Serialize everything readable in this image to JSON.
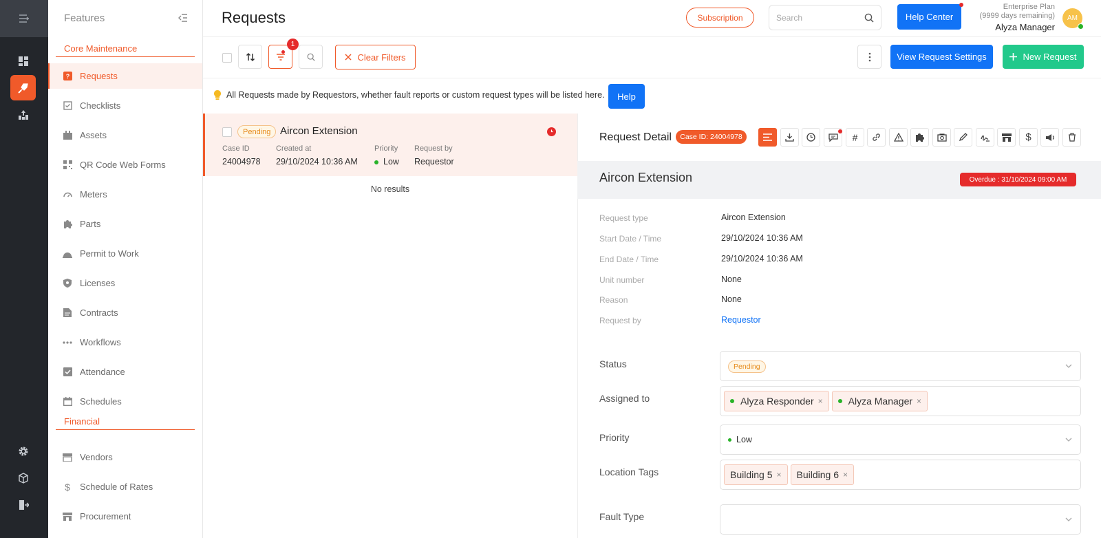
{
  "rail": {
    "icons": [
      "menu-icon",
      "dashboard-icon",
      "maintenance-icon",
      "analytics-icon",
      "settings-icon",
      "cube-icon",
      "logout-icon"
    ]
  },
  "sidebar": {
    "title": "Features",
    "sections": [
      {
        "label": "Core Maintenance"
      },
      {
        "label": "Financial"
      }
    ],
    "items": [
      {
        "label": "Requests"
      },
      {
        "label": "Checklists"
      },
      {
        "label": "Assets"
      },
      {
        "label": "QR Code Web Forms"
      },
      {
        "label": "Meters"
      },
      {
        "label": "Parts"
      },
      {
        "label": "Permit to Work"
      },
      {
        "label": "Licenses"
      },
      {
        "label": "Contracts"
      },
      {
        "label": "Workflows"
      },
      {
        "label": "Attendance"
      },
      {
        "label": "Schedules"
      },
      {
        "label": "Vendors"
      },
      {
        "label": "Schedule of Rates"
      },
      {
        "label": "Procurement"
      }
    ]
  },
  "header": {
    "title": "Requests",
    "subscription_label": "Subscription",
    "search_placeholder": "Search",
    "help_center_label": "Help Center",
    "plan": "Enterprise Plan",
    "days_remaining": "(9999 days remaining)",
    "user_name": "Alyza Manager",
    "avatar_initials": "AM"
  },
  "toolbar": {
    "filter_count": "1",
    "clear_filters_label": "Clear Filters",
    "view_settings_label": "View Request Settings",
    "new_request_label": "New Request"
  },
  "info": {
    "text": "All Requests made by Requestors, whether fault reports or custom request types will be listed here.",
    "help_label": "Help"
  },
  "list": {
    "item": {
      "status": "Pending",
      "title": "Aircon Extension",
      "case_id_label": "Case ID",
      "case_id": "24004978",
      "created_label": "Created at",
      "created": "29/10/2024 10:36 AM",
      "priority_label": "Priority",
      "priority": "Low",
      "request_by_label": "Request by",
      "request_by": "Requestor"
    },
    "empty_text": "No results"
  },
  "detail": {
    "heading": "Request Detail",
    "case_badge": "Case ID: 24004978",
    "title": "Aircon Extension",
    "overdue": "Overdue : 31/10/2024 09:00 AM",
    "fields": [
      {
        "label": "Request type",
        "value": "Aircon Extension"
      },
      {
        "label": "Start Date / Time",
        "value": "29/10/2024 10:36 AM"
      },
      {
        "label": "End Date / Time",
        "value": "29/10/2024 10:36 AM"
      },
      {
        "label": "Unit number",
        "value": "None"
      },
      {
        "label": "Reason",
        "value": "None"
      },
      {
        "label": "Request by",
        "value": "Requestor"
      }
    ],
    "status_label": "Status",
    "status_value": "Pending",
    "assigned_label": "Assigned to",
    "assigned": [
      "Alyza Responder",
      "Alyza Manager"
    ],
    "priority_label": "Priority",
    "priority_value": "Low",
    "location_label": "Location Tags",
    "locations": [
      "Building 5",
      "Building 6"
    ],
    "fault_label": "Fault Type",
    "toolbar_icons": [
      "description-icon",
      "download-icon",
      "clock-icon",
      "comment-icon",
      "hash-icon",
      "link-icon",
      "warning-icon",
      "puzzle-icon",
      "camera-icon",
      "pencil-icon",
      "signature-icon",
      "store-icon",
      "dollar-icon",
      "megaphone-icon",
      "trash-icon"
    ]
  },
  "colors": {
    "accent": "#f05a2a",
    "primary": "#1173f6",
    "success": "#22c98b",
    "danger": "#e52b2b"
  }
}
